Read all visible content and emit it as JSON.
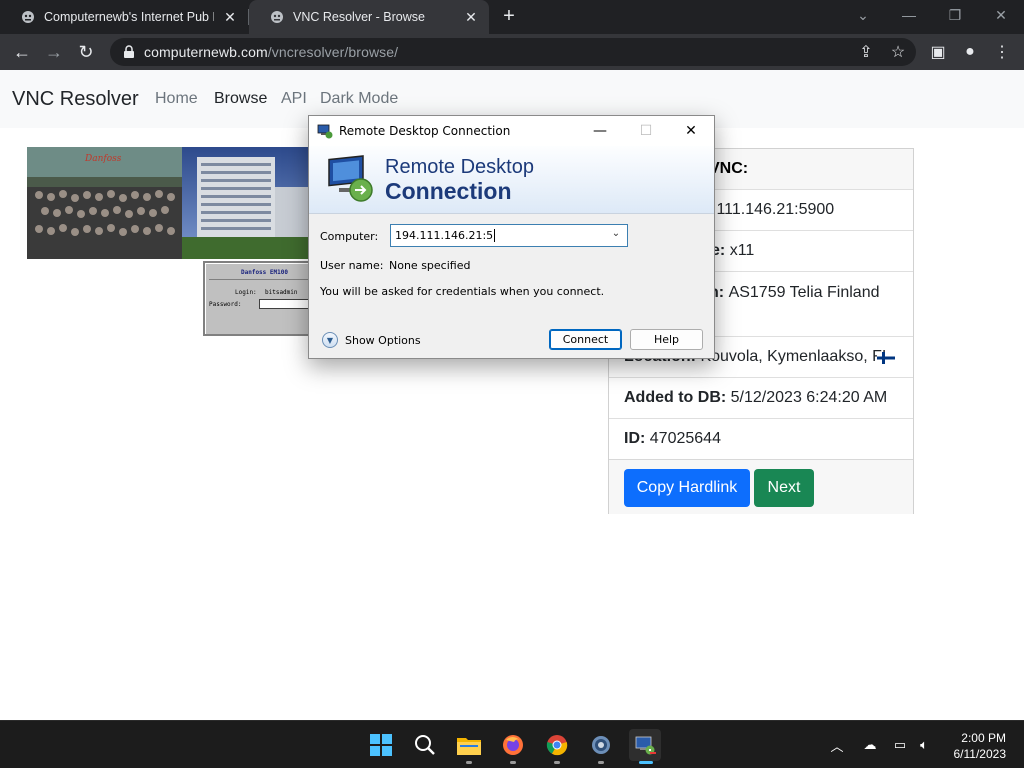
{
  "browser": {
    "tabs": [
      {
        "title": "Computernewb's Internet Pub Hub",
        "active": false
      },
      {
        "title": "VNC Resolver - Browse",
        "active": true
      }
    ],
    "address": {
      "domain": "computernewb.com",
      "path": "/vncresolver/browse/"
    }
  },
  "site": {
    "brand": "VNC Resolver",
    "nav": [
      "Home",
      "Browse",
      "API",
      "Dark Mode"
    ]
  },
  "card": {
    "header_visible": "VNC:",
    "rows": [
      {
        "label": "",
        "value": ".111.146.21:5900"
      },
      {
        "label": "e:",
        "value": "x11"
      },
      {
        "label": "n:",
        "value": "AS1759 Telia Finland"
      },
      {
        "label": "Location:",
        "value": "Kouvola, Kymenlaakso, FI"
      },
      {
        "label": "Added to DB:",
        "value": "5/12/2023 6:24:20 AM"
      },
      {
        "label": "ID:",
        "value": "47025644"
      }
    ],
    "buttons": {
      "copy": "Copy Hardlink",
      "next": "Next"
    }
  },
  "screenshot_inset": {
    "title": "Danfoss EM100",
    "login_label": "Login:",
    "login_value": "bitsadmin",
    "password_label": "Password:"
  },
  "rdp_dialog": {
    "title": "Remote Desktop Connection",
    "header_line1": "Remote Desktop",
    "header_line2": "Connection",
    "computer_label": "Computer:",
    "computer_value": "194.111.146.21:5",
    "username_label": "User name:",
    "username_value": "None specified",
    "info": "You will be asked for credentials when you connect.",
    "show_options": "Show Options",
    "connect": "Connect",
    "help": "Help"
  },
  "taskbar": {
    "apps": [
      "start-icon",
      "search-icon",
      "file-explorer-icon",
      "firefox-icon",
      "chrome-icon",
      "settings-icon",
      "remote-desktop-icon"
    ],
    "time": "2:00 PM",
    "date": "6/11/2023"
  },
  "colors": {
    "primary": "#0d6efd",
    "success": "#198754",
    "chrome_dark": "#202124",
    "taskbar": "#1c1c1c",
    "rdp_title_blue": "#1c3a7a"
  }
}
